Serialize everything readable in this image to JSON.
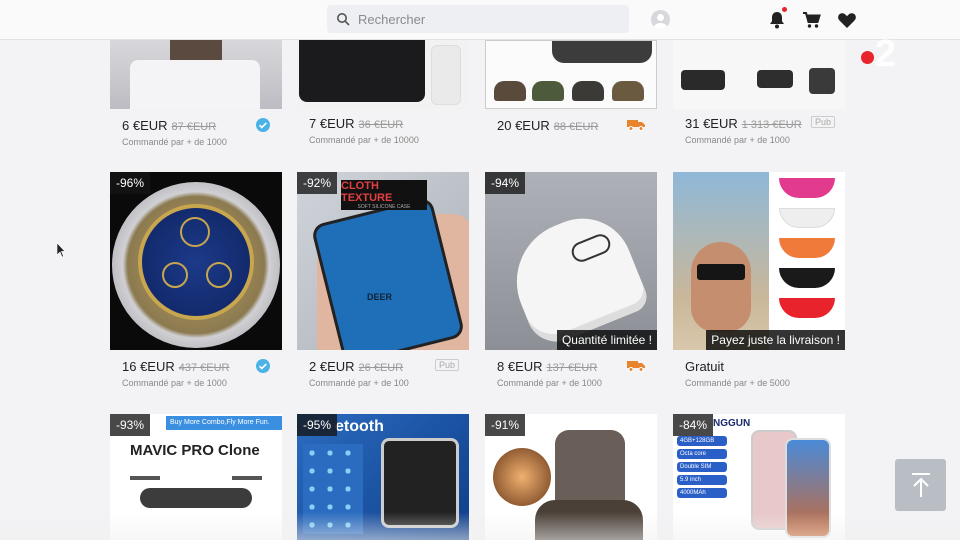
{
  "header": {
    "search_placeholder": "Rechercher",
    "icons": [
      "search-icon",
      "avatar-icon",
      "bell-icon",
      "cart-icon",
      "heart-icon"
    ]
  },
  "channel_logo": {
    "text": "2",
    "dot_color": "#e8232b"
  },
  "colors": {
    "verified": "#4ab2e6",
    "shipping": "#e8842d",
    "badge_bg": "#141414"
  },
  "rows": [
    {
      "cards": [
        {
          "price": "6 €EUR",
          "old_price": "87 €EUR",
          "ordered": "Commandé par + de 1000",
          "tag": "verified"
        },
        {
          "price": "7 €EUR",
          "old_price": "36 €EUR",
          "ordered": "Commandé par + de 10000",
          "tag": ""
        },
        {
          "price": "20 €EUR",
          "old_price": "88 €EUR",
          "ordered": "",
          "tag": "shipping"
        },
        {
          "price": "31 €EUR",
          "old_price": "1 313 €EUR",
          "ordered": "Commandé par + de 1000",
          "tag": "Pub"
        }
      ]
    },
    {
      "cards": [
        {
          "discount": "-96%",
          "price": "16 €EUR",
          "old_price": "437 €EUR",
          "ordered": "Commandé par + de 1000",
          "tag": "verified",
          "ribbon": ""
        },
        {
          "discount": "-92%",
          "price": "2 €EUR",
          "old_price": "26 €EUR",
          "ordered": "Commandé par + de 100",
          "tag": "Pub",
          "ribbon": "",
          "img_text_title": "CLOTH TEXTURE",
          "img_text_sub": "SOFT SILICONE CASE",
          "img_text_brand": "DEER"
        },
        {
          "discount": "-94%",
          "price": "8 €EUR",
          "old_price": "137 €EUR",
          "ordered": "Commandé par + de 1000",
          "tag": "shipping",
          "ribbon": "Quantité limitée !"
        },
        {
          "discount": "",
          "price": "Gratuit",
          "old_price": "",
          "ordered": "Commandé par + de 5000",
          "tag": "",
          "ribbon": "Payez juste la livraison !"
        }
      ]
    },
    {
      "cards": [
        {
          "discount": "-93%",
          "img_title": "MAVIC PRO Clone",
          "img_banner": "Buy More Combo,Fly More Fun."
        },
        {
          "discount": "-95%",
          "img_title": "etooth"
        },
        {
          "discount": "-91%"
        },
        {
          "discount": "-84%",
          "img_title": "NGGUN",
          "img_specs": [
            "4GB+128GB",
            "Octa core",
            "Double SIM",
            "5.9 inch",
            "4000MAh"
          ]
        }
      ]
    }
  ]
}
